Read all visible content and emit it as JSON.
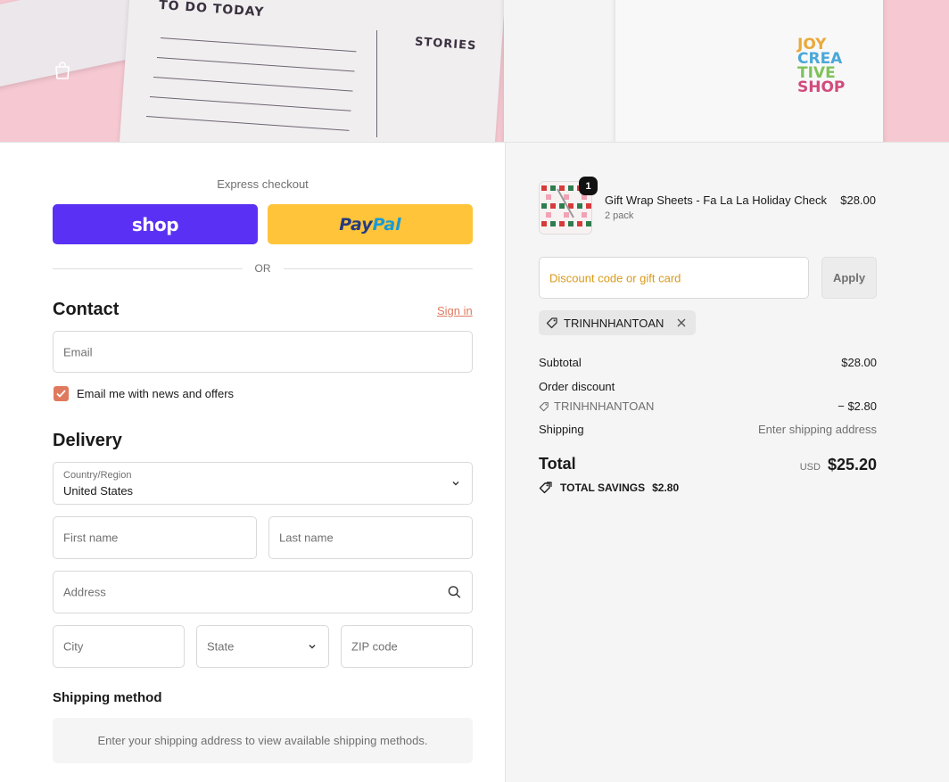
{
  "header": {
    "banner_text_todo": "TO DO TODAY",
    "banner_text_stories": "STORIES",
    "logo_lines": [
      "JOY",
      "CREA",
      "TIVE",
      "SHOP"
    ]
  },
  "express": {
    "label": "Express checkout",
    "shop_label": "shop",
    "paypal_part1": "Pay",
    "paypal_part2": "Pal",
    "or_text": "OR"
  },
  "contact": {
    "title": "Contact",
    "signin_label": "Sign in",
    "email_placeholder": "Email",
    "newsletter_label": "Email me with news and offers",
    "newsletter_checked": true
  },
  "delivery": {
    "title": "Delivery",
    "country_label": "Country/Region",
    "country_value": "United States",
    "first_name_placeholder": "First name",
    "last_name_placeholder": "Last name",
    "address_placeholder": "Address",
    "city_placeholder": "City",
    "state_placeholder": "State",
    "zip_placeholder": "ZIP code"
  },
  "shipping": {
    "title": "Shipping method",
    "notice": "Enter your shipping address to view available shipping methods."
  },
  "summary": {
    "item": {
      "quantity": "1",
      "name": "Gift Wrap Sheets - Fa La La Holiday Check",
      "variant": "2 pack",
      "price": "$28.00"
    },
    "discount_placeholder": "Discount code or gift card",
    "apply_label": "Apply",
    "applied_code": "TRINHNHANTOAN",
    "subtotal_label": "Subtotal",
    "subtotal_value": "$28.00",
    "order_discount_label": "Order discount",
    "discount_code": "TRINHNHANTOAN",
    "discount_value": "− $2.80",
    "shipping_label": "Shipping",
    "shipping_value": "Enter shipping address",
    "total_label": "Total",
    "currency": "USD",
    "total_value": "$25.20",
    "savings_label": "TOTAL SAVINGS",
    "savings_value": "$2.80"
  },
  "colors": {
    "shop_button": "#5a31f4",
    "paypal_button": "#ffc439",
    "accent": "#e07a5f",
    "banner_bg": "#f6c8d2"
  }
}
